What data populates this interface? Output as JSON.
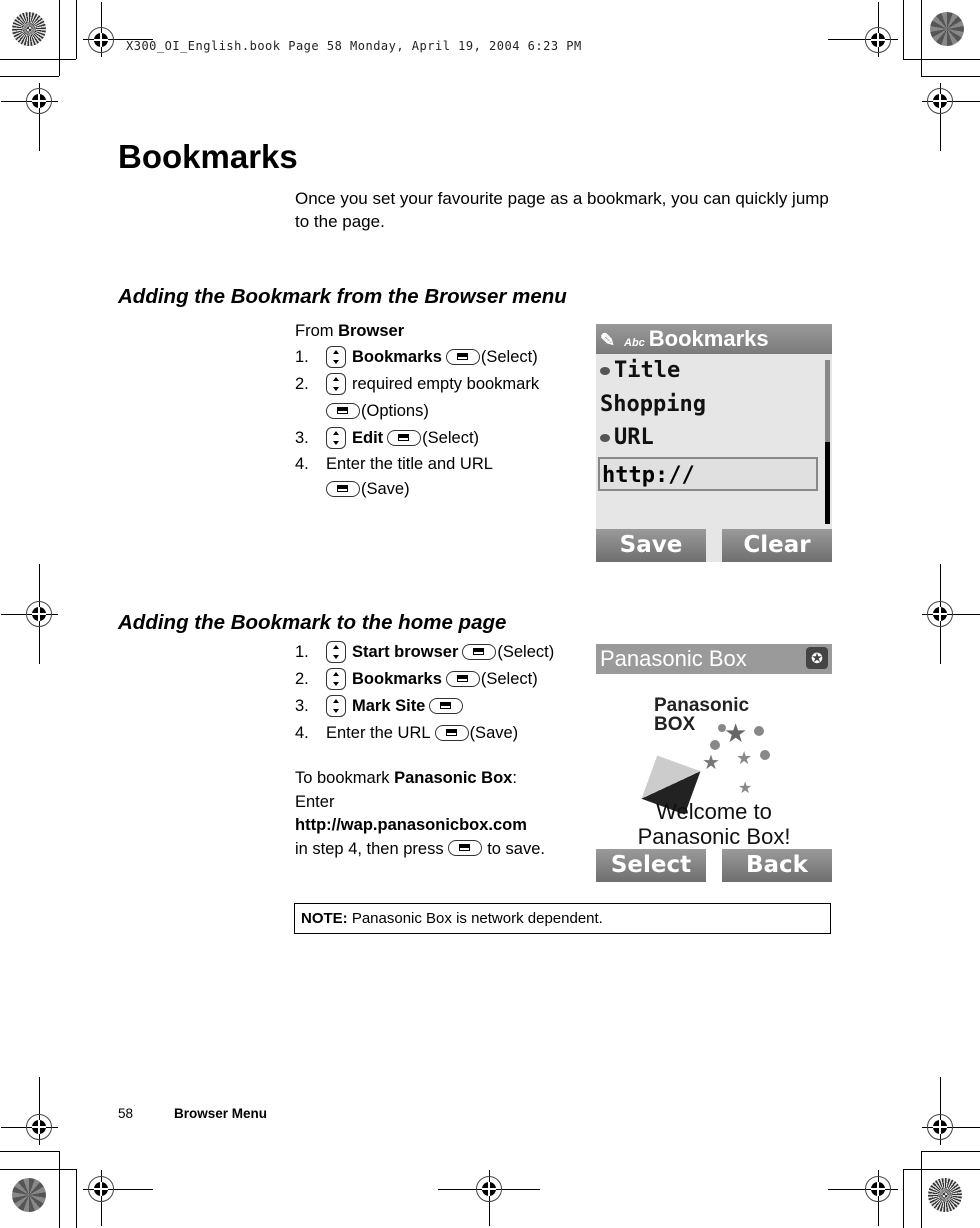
{
  "print_header": "X300_OI_English.book  Page 58  Monday, April 19, 2004  6:23 PM",
  "title": "Bookmarks",
  "intro": "Once you set your favourite page as a bookmark, you can quickly jump to the page.",
  "section1": {
    "heading": "Adding the Bookmark from the Browser menu",
    "from_label": "From",
    "from_value": "Browser",
    "steps": [
      {
        "num": "1.",
        "bold": "Bookmarks",
        "action": "(Select)"
      },
      {
        "num": "2.",
        "text": "required empty bookmark",
        "action": "(Options)"
      },
      {
        "num": "3.",
        "bold": "Edit",
        "action": "(Select)"
      },
      {
        "num": "4.",
        "text": "Enter the title and URL",
        "action": "(Save)"
      }
    ],
    "screen": {
      "title": "Bookmarks",
      "mode_icon_text": "Abc",
      "lines": [
        "Title",
        "Shopping",
        "URL"
      ],
      "url_value": "http://",
      "left_softkey": "Save",
      "right_softkey": "Clear"
    }
  },
  "section2": {
    "heading": "Adding the Bookmark to the home page",
    "steps": [
      {
        "num": "1.",
        "bold": "Start browser",
        "action": "(Select)"
      },
      {
        "num": "2.",
        "bold": "Bookmarks",
        "action": "(Select)"
      },
      {
        "num": "3.",
        "bold": "Mark Site",
        "action": ""
      },
      {
        "num": "4.",
        "text": "Enter the URL",
        "action": "(Save)"
      }
    ],
    "tip": {
      "prefix": "To bookmark",
      "bold": "Panasonic Box",
      "suffix": ":",
      "enter": "Enter",
      "url": "http://wap.panasonicbox.com",
      "line4_a": "in step 4, then press",
      "line4_b": "to save."
    },
    "screen": {
      "title": "Panasonic Box",
      "logo_line1": "Panasonic",
      "logo_line2": "BOX",
      "welcome_1": "Welcome to",
      "welcome_2": "Panasonic Box!",
      "left_softkey": "Select",
      "right_softkey": "Back"
    }
  },
  "note": {
    "label": "NOTE:",
    "text": " Panasonic Box is network dependent."
  },
  "footer": {
    "page_number": "58",
    "section": "Browser Menu"
  }
}
